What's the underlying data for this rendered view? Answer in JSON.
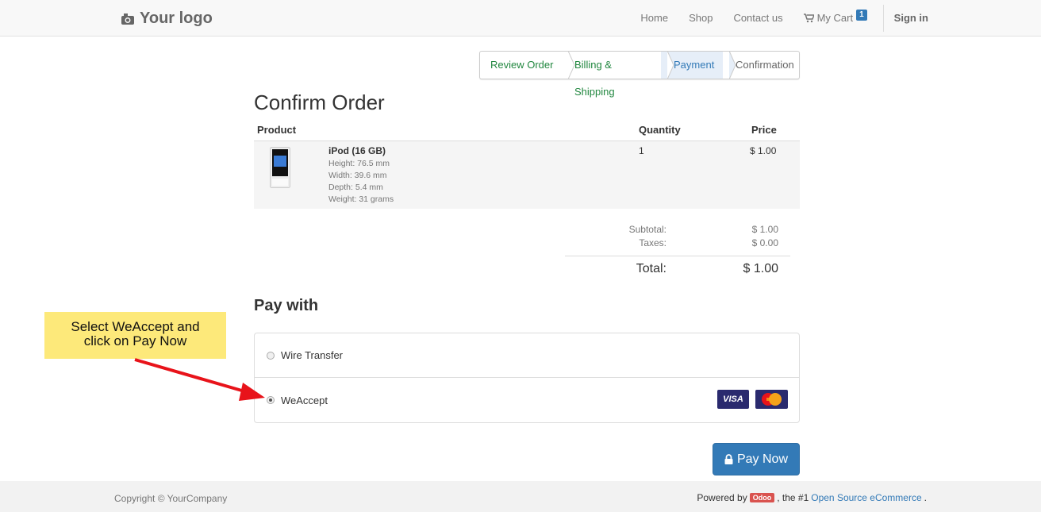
{
  "navbar": {
    "logo_text": "Your logo",
    "links": [
      "Home",
      "Shop",
      "Contact us"
    ],
    "cart_label": "My Cart",
    "cart_count": "1",
    "signin": "Sign in"
  },
  "wizard": {
    "steps": [
      "Review Order",
      "Billing & Shipping",
      "Payment",
      "Confirmation"
    ],
    "active_step": "Payment"
  },
  "order": {
    "title": "Confirm Order",
    "headers": {
      "product": "Product",
      "quantity": "Quantity",
      "price": "Price"
    },
    "items": [
      {
        "name": "iPod (16 GB)",
        "attributes": [
          "Height: 76.5 mm",
          "Width: 39.6 mm",
          "Depth: 5.4 mm",
          "Weight: 31 grams"
        ],
        "quantity": "1",
        "price": "$ 1.00"
      }
    ],
    "subtotal_label": "Subtotal:",
    "subtotal": "$ 1.00",
    "taxes_label": "Taxes:",
    "taxes": "$ 0.00",
    "total_label": "Total:",
    "total": "$ 1.00"
  },
  "payment": {
    "title": "Pay with",
    "options": [
      {
        "label": "Wire Transfer",
        "selected": false
      },
      {
        "label": "WeAccept",
        "selected": true
      }
    ],
    "visa_label": "VISA",
    "pay_button": "Pay Now"
  },
  "annotation": {
    "text_line1": "Select WeAccept and",
    "text_line2": "click on Pay Now"
  },
  "footer": {
    "copyright": "Copyright © YourCompany",
    "powered_prefix": "Powered by",
    "odoo_badge": "Odoo",
    "powered_mid": ", the #1",
    "powered_link": "Open Source eCommerce",
    "powered_suffix": "."
  },
  "colors": {
    "primary": "#337ab7",
    "success_step": "#21873f",
    "annotation_bg": "#fde97a",
    "arrow": "#e8131a",
    "card_bg": "#2a2a6e"
  }
}
